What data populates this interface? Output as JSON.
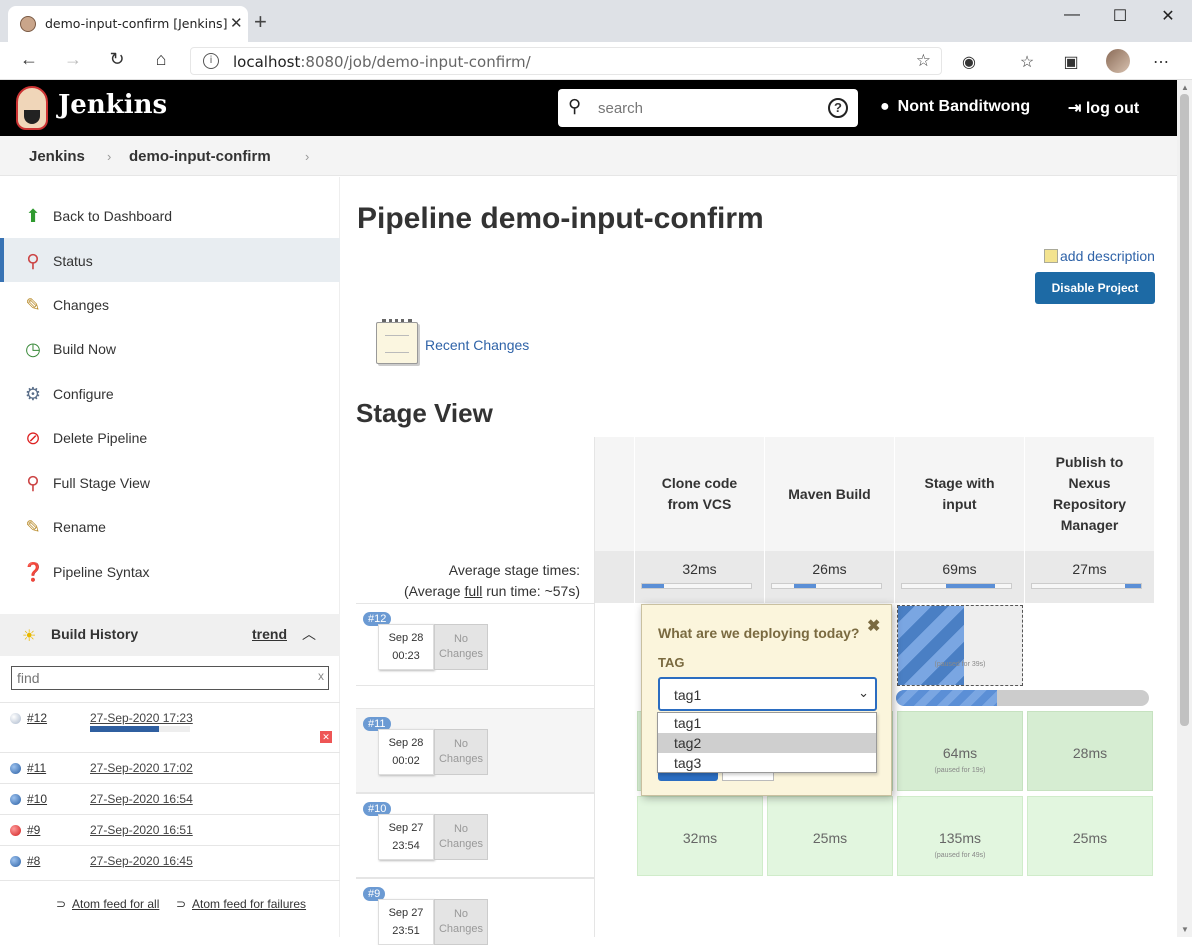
{
  "browser": {
    "tab_title": "demo-input-confirm [Jenkins]",
    "url_host": "localhost",
    "url_path": ":8080/job/demo-input-confirm/",
    "min": "—",
    "max": "☐",
    "close": "✕"
  },
  "header": {
    "brand": "Jenkins",
    "search_placeholder": "search",
    "user": "Nont Banditwong",
    "logout": "log out"
  },
  "breadcrumb": [
    "Jenkins",
    "demo-input-confirm"
  ],
  "sidebar": {
    "items": [
      {
        "label": "Back to Dashboard",
        "icon": "up-arrow-icon"
      },
      {
        "label": "Status",
        "icon": "magnifier-icon"
      },
      {
        "label": "Changes",
        "icon": "notepad-icon"
      },
      {
        "label": "Build Now",
        "icon": "clock-play-icon"
      },
      {
        "label": "Configure",
        "icon": "gear-icon"
      },
      {
        "label": "Delete Pipeline",
        "icon": "no-entry-icon"
      },
      {
        "label": "Full Stage View",
        "icon": "magnifier-icon"
      },
      {
        "label": "Rename",
        "icon": "notepad-icon"
      },
      {
        "label": "Pipeline Syntax",
        "icon": "help-icon"
      }
    ],
    "build_history": {
      "title": "Build History",
      "trend": "trend",
      "find_placeholder": "find",
      "builds": [
        {
          "num": "#12",
          "date": "27-Sep-2020 17:23",
          "status": "running"
        },
        {
          "num": "#11",
          "date": "27-Sep-2020 17:02",
          "status": "success"
        },
        {
          "num": "#10",
          "date": "27-Sep-2020 16:54",
          "status": "success"
        },
        {
          "num": "#9",
          "date": "27-Sep-2020 16:51",
          "status": "failed"
        },
        {
          "num": "#8",
          "date": "27-Sep-2020 16:45",
          "status": "success"
        }
      ],
      "feed_all": "Atom feed for all",
      "feed_failures": "Atom feed for failures"
    }
  },
  "main": {
    "title": "Pipeline demo-input-confirm",
    "add_description": "add description",
    "disable_button": "Disable Project",
    "recent_changes": "Recent Changes",
    "stage_view_title": "Stage View",
    "avg_label": "Average stage times:",
    "avg_full_prefix": "(Average ",
    "avg_full_word": "full",
    "avg_full_suffix": " run time: ~57s)",
    "stages": [
      {
        "name": [
          "Clone code",
          "from VCS"
        ],
        "avg": "32ms",
        "fill_from": 0.0,
        "fill_to": 0.2
      },
      {
        "name": [
          "Maven Build"
        ],
        "avg": "26ms",
        "fill_from": 0.2,
        "fill_to": 0.4
      },
      {
        "name": [
          "Stage with",
          "input"
        ],
        "avg": "69ms",
        "fill_from": 0.4,
        "fill_to": 0.85
      },
      {
        "name": [
          "Publish to",
          "Nexus",
          "Repository",
          "Manager"
        ],
        "avg": "27ms",
        "fill_from": 0.85,
        "fill_to": 1.0
      }
    ],
    "builds": [
      {
        "badge": "#12",
        "month": "Sep 28",
        "time": "00:23",
        "changes": [
          "No",
          "Changes"
        ],
        "paused": "(paused for 39s)"
      },
      {
        "badge": "#11",
        "month": "Sep 28",
        "time": "00:02",
        "changes": [
          "No",
          "Changes"
        ],
        "cells": [
          {
            "v": "",
            "p": ""
          },
          {
            "v": "",
            "p": ""
          },
          {
            "v": "64ms",
            "p": "(paused for 19s)"
          },
          {
            "v": "28ms",
            "p": ""
          }
        ]
      },
      {
        "badge": "#10",
        "month": "Sep 27",
        "time": "23:54",
        "changes": [
          "No",
          "Changes"
        ],
        "cells": [
          {
            "v": "32ms",
            "p": ""
          },
          {
            "v": "25ms",
            "p": ""
          },
          {
            "v": "135ms",
            "p": "(paused for 49s)"
          },
          {
            "v": "25ms",
            "p": ""
          }
        ]
      },
      {
        "badge": "#9",
        "month": "Sep 27",
        "time": "23:51",
        "changes": [
          "No",
          "Changes"
        ]
      }
    ],
    "running_progress": 0.4
  },
  "input_popup": {
    "question": "What are we deploying today?",
    "close": "✖",
    "param_label": "TAG",
    "selected": "tag1",
    "options": [
      "tag1",
      "tag2",
      "tag3"
    ],
    "highlighted": "tag2"
  }
}
